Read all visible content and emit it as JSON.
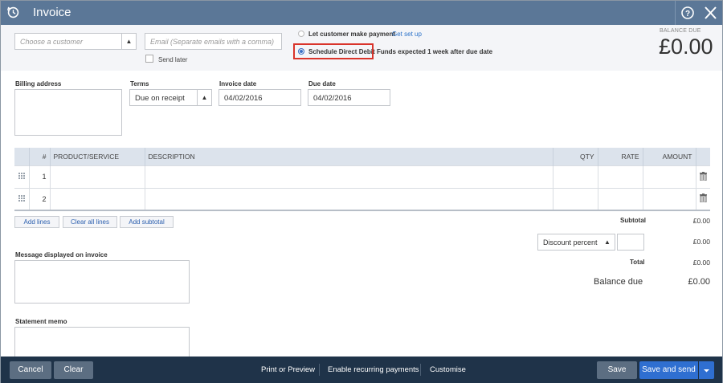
{
  "window": {
    "title": "Invoice",
    "title_color": "#5b7797"
  },
  "customer": {
    "placeholder": "Choose a customer",
    "email_placeholder": "Email (Separate emails with a comma)",
    "send_later_label": "Send later"
  },
  "payment": {
    "let_customer_label": "Let customer make payment",
    "get_set_up_link": "Get set up",
    "direct_debit_label": "Schedule Direct Debit",
    "direct_debit_note": "Funds expected 1 week after due date",
    "selected": "Schedule Direct Debit"
  },
  "balance": {
    "label": "BALANCE DUE",
    "amount": "£0.00"
  },
  "fields": {
    "billing_address_label": "Billing address",
    "terms_label": "Terms",
    "terms_value": "Due on receipt",
    "invoice_date_label": "Invoice date",
    "invoice_date_value": "04/02/2016",
    "due_date_label": "Due date",
    "due_date_value": "04/02/2016"
  },
  "table": {
    "headers": [
      "#",
      "PRODUCT/SERVICE",
      "DESCRIPTION",
      "QTY",
      "RATE",
      "AMOUNT"
    ],
    "rows": [
      {
        "num": "1"
      },
      {
        "num": "2"
      }
    ]
  },
  "line_buttons": {
    "add_lines": "Add lines",
    "clear_all_lines": "Clear all lines",
    "add_subtotal": "Add subtotal"
  },
  "totals": {
    "subtotal_label": "Subtotal",
    "subtotal_value": "£0.00",
    "discount_select": "Discount percent",
    "discount_value": "£0.00",
    "total_label": "Total",
    "total_value": "£0.00",
    "balance_due_label": "Balance due",
    "balance_due_value": "£0.00"
  },
  "message": {
    "label": "Message displayed on invoice",
    "memo_label": "Statement memo"
  },
  "footer": {
    "cancel": "Cancel",
    "clear": "Clear",
    "print_preview": "Print or Preview",
    "recurring": "Enable recurring payments",
    "customise": "Customise",
    "save": "Save",
    "save_send": "Save and send",
    "primary_color": "#2f6fd1"
  }
}
